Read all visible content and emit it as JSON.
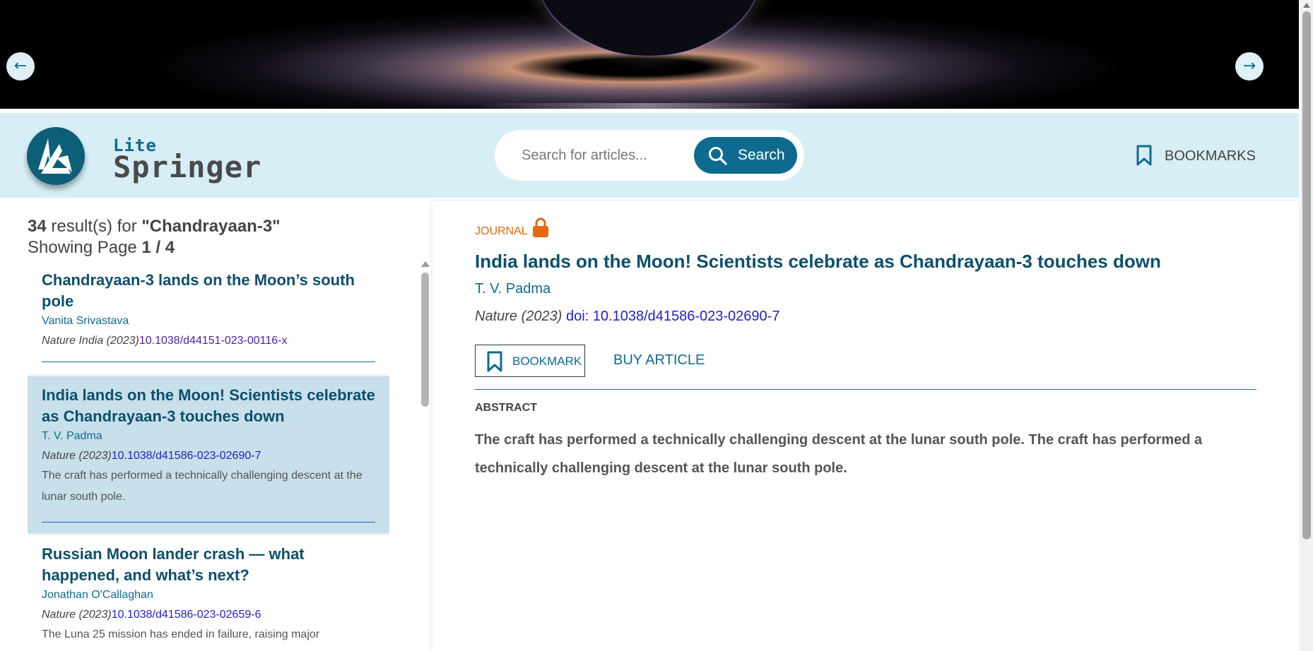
{
  "hero": {
    "prev_symbol": "←",
    "next_symbol": "→"
  },
  "header": {
    "logo_top": "Lite",
    "logo_name": "Springer",
    "search_placeholder": "Search for articles...",
    "search_button": "Search",
    "bookmarks_link": "BOOKMARKS"
  },
  "results": {
    "count": "34",
    "count_suffix": " result(s) for ",
    "query": "\"Chandrayaan-3\"",
    "page_prefix": "Showing Page ",
    "page": "1 / 4"
  },
  "articles": [
    {
      "title": "Chandrayaan-3 lands on the Moon’s south pole",
      "author": "Vanita Srivastava",
      "journal": "Nature India (2023)",
      "doi": "10.1038/d44151-023-00116-x"
    },
    {
      "title": "India lands on the Moon! Scientists celebrate as Chandrayaan-3 touches down",
      "author": "T. V. Padma",
      "journal": "Nature (2023)",
      "doi": "10.1038/d41586-023-02690-7",
      "abstract": "The craft has performed a technically challenging descent at the lunar south pole."
    },
    {
      "title": "Russian Moon lander crash — what happened, and what’s next?",
      "author": "Jonathan O'Callaghan",
      "journal": "Nature (2023)",
      "doi": "10.1038/d41586-023-02659-6",
      "abstract": "The Luna 25 mission has ended in failure, raising major"
    }
  ],
  "detail": {
    "type_label": "JOURNAL",
    "title": "India lands on the Moon! Scientists celebrate as Chandrayaan-3 touches down",
    "author": "T. V. Padma",
    "journal": "Nature (2023)",
    "doi_label": "doi: 10.1038/d41586-023-02690-7",
    "bookmark_button": "BOOKMARK",
    "buy_button": "BUY ARTICLE",
    "abstract_label": "ABSTRACT",
    "abstract": "The craft has performed a technically challenging descent at the lunar south pole. The craft has performed a technically challenging descent at the lunar south pole."
  },
  "colors": {
    "brand": "#0e6b8f",
    "header_bg": "#d7eef6",
    "selected_card": "#c7e0ea",
    "journal_accent": "#e8680f"
  }
}
